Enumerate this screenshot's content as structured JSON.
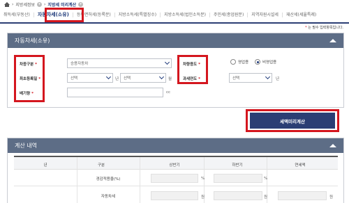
{
  "breadcrumb": {
    "level1": "지방세정보",
    "level2": "지방세 미리계산"
  },
  "tabs": [
    {
      "label": "취득세(부동산)",
      "active": false
    },
    {
      "label": "자동차세(소유)",
      "active": true
    },
    {
      "label": "등록면허세(등록분)",
      "active": false
    },
    {
      "label": "지방소득세(특별징수)",
      "active": false
    },
    {
      "label": "지방소득세(법인소득분)",
      "active": false
    },
    {
      "label": "주민세(종업원분)",
      "active": false
    },
    {
      "label": "지역자원시설세",
      "active": false
    },
    {
      "label": "재산세(세율특례)",
      "active": false
    }
  ],
  "required_note": {
    "star": "*",
    "text": " 는 필수 입력항목입니다."
  },
  "form": {
    "title": "자동차세(소유)",
    "vehicle_type": {
      "label": "차종구분",
      "star": "*",
      "value": "승용자동차"
    },
    "first_registration": {
      "label": "최초등록일",
      "star": "*",
      "year": "선택",
      "month": "선택",
      "year_unit": "년",
      "month_unit": "월"
    },
    "displacement": {
      "label": "배기량",
      "star": "*",
      "value": "",
      "unit": "cc"
    },
    "vehicle_use": {
      "label": "차량용도",
      "star": "*",
      "options": [
        "영업용",
        "비영업용"
      ],
      "selected": "비영업용"
    },
    "tax_year": {
      "label": "과세연도",
      "star": "*",
      "value": "선택",
      "unit": "년"
    }
  },
  "calc_button": {
    "label": "세액미리계산"
  },
  "result": {
    "title": "계산 내역",
    "headers": [
      "년",
      "구분",
      "상반기",
      "하반기",
      "연세액"
    ],
    "rows": [
      {
        "label": "경감적용율(%)",
        "unit1": "%",
        "unit2": "%"
      },
      {
        "label": "자동차세",
        "unit1": "원",
        "unit2": "원",
        "unit3": "원"
      }
    ]
  }
}
